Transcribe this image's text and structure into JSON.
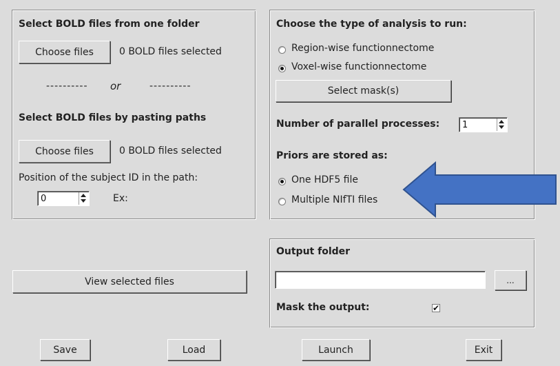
{
  "left_panel": {
    "section1_title": "Select BOLD files from one folder",
    "choose_files_label": "Choose files",
    "files_selected_1": "0 BOLD files selected",
    "separator_left": "----------",
    "separator_or": "or",
    "separator_right": "----------",
    "section2_title": "Select BOLD files by pasting paths",
    "choose_files_label_2": "Choose files",
    "files_selected_2": "0 BOLD files selected",
    "subject_id_label": "Position of the subject ID in the path:",
    "subject_id_value": "0",
    "example_label": "Ex:"
  },
  "view_selected_label": "View selected files",
  "right_panel": {
    "analysis_title": "Choose the type of analysis to run:",
    "option_region": "Region-wise functionnectome",
    "option_voxel": "Voxel-wise functionnectome",
    "selected_analysis": "voxel",
    "select_mask_label": "Select mask(s)",
    "parallel_label": "Number of parallel processes:",
    "parallel_value": "1",
    "priors_title": "Priors are stored as:",
    "option_hdf5": "One HDF5 file",
    "option_nifti": "Multiple NIfTI files",
    "selected_priors": "hdf5"
  },
  "output_panel": {
    "title": "Output folder",
    "path_value": "",
    "browse_label": "...",
    "mask_label": "Mask the output:",
    "mask_checked": true,
    "mask_glyph": "✔"
  },
  "bottom_buttons": {
    "save": "Save",
    "load": "Load",
    "launch": "Launch",
    "exit": "Exit"
  },
  "annotation": {
    "arrow_color": "#4472c4",
    "arrow_outline": "#2f528f"
  }
}
